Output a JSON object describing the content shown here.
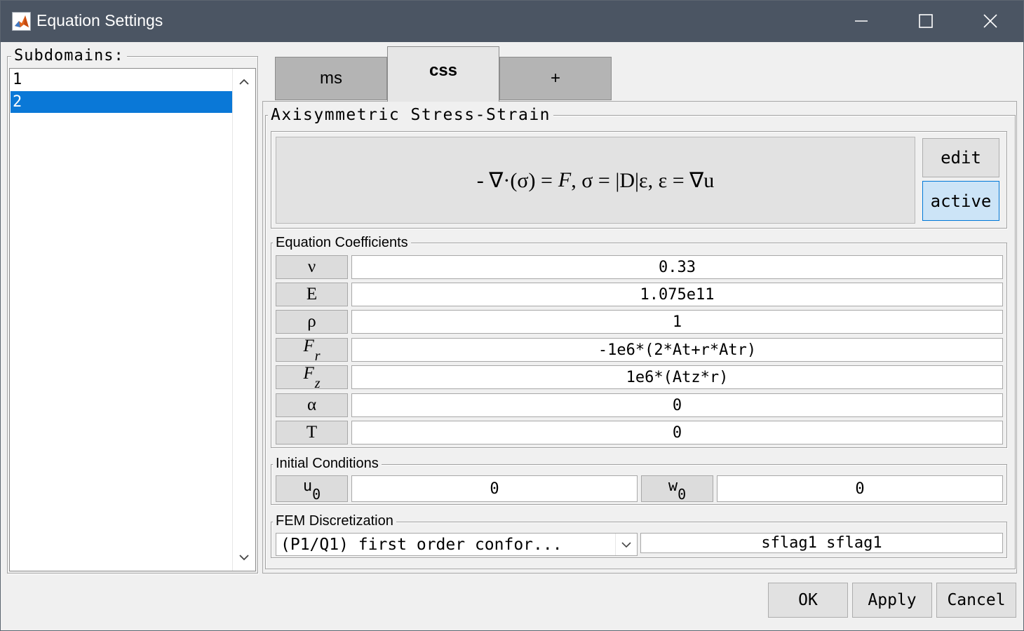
{
  "window": {
    "title": "Equation Settings",
    "controls": {
      "minimize_icon": "minimize-icon",
      "maximize_icon": "maximize-icon",
      "close_icon": "close-icon"
    },
    "titlebar_color": "#4b5563"
  },
  "subdomains": {
    "legend": "Subdomains:",
    "items": [
      "1",
      "2"
    ],
    "selected": "2",
    "selected_color": "#0a78d7"
  },
  "tabs": [
    {
      "label": "ms",
      "active": false
    },
    {
      "label": "css",
      "active": true
    },
    {
      "label": "+",
      "active": false
    }
  ],
  "equation_panel": {
    "legend": "Axisymmetric Stress-Strain",
    "equation": {
      "part1": "- ∇·(σ) = ",
      "part2": "F",
      "part3": ", σ = |D|ε, ε = ∇u"
    },
    "edit_button": "edit",
    "active_button": "active"
  },
  "coefficients": {
    "legend": "Equation Coefficients",
    "rows": [
      {
        "label": "ν",
        "sub": "",
        "value": "0.33"
      },
      {
        "label": "E",
        "sub": "",
        "value": "1.075e11"
      },
      {
        "label": "ρ",
        "sub": "",
        "value": "1"
      },
      {
        "label": "F",
        "sub": "r",
        "value": "-1e6*(2*At+r*Atr)"
      },
      {
        "label": "F",
        "sub": "z",
        "value": "1e6*(Atz*r)"
      },
      {
        "label": "α",
        "sub": "",
        "value": "0"
      },
      {
        "label": "T",
        "sub": "",
        "value": "0"
      }
    ]
  },
  "initial_conditions": {
    "legend": "Initial Conditions",
    "u0": {
      "label": "u",
      "sub": "0",
      "value": "0"
    },
    "w0": {
      "label": "w",
      "sub": "0",
      "value": "0"
    }
  },
  "fem": {
    "legend": "FEM Discretization",
    "selected_option": "(P1/Q1) first order confor...",
    "flags": "sflag1 sflag1"
  },
  "buttons": {
    "ok": "OK",
    "apply": "Apply",
    "cancel": "Cancel"
  }
}
